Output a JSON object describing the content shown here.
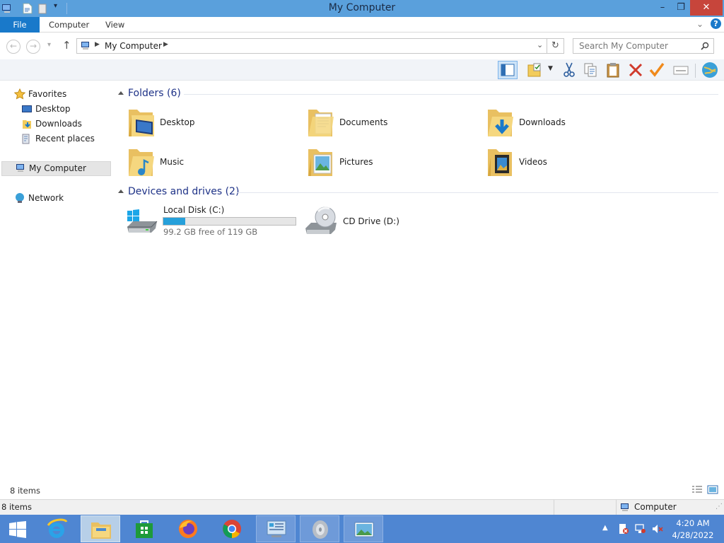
{
  "window": {
    "title": "My Computer",
    "controls": {
      "minimize": "–",
      "restore": "❐",
      "close": "✕"
    }
  },
  "ribbon": {
    "tabs": [
      {
        "label": "File"
      },
      {
        "label": "Computer"
      },
      {
        "label": "View"
      }
    ]
  },
  "address": {
    "path": "My Computer",
    "search_placeholder": "Search My Computer"
  },
  "nav": {
    "favorites": "Favorites",
    "desktop": "Desktop",
    "downloads": "Downloads",
    "recent": "Recent places",
    "computer": "My Computer",
    "network": "Network"
  },
  "content": {
    "folders_header": "Folders (6)",
    "folders": [
      {
        "label": "Desktop",
        "icon": "desktop-folder-icon"
      },
      {
        "label": "Documents",
        "icon": "documents-folder-icon"
      },
      {
        "label": "Downloads",
        "icon": "downloads-folder-icon"
      },
      {
        "label": "Music",
        "icon": "music-folder-icon"
      },
      {
        "label": "Pictures",
        "icon": "pictures-folder-icon"
      },
      {
        "label": "Videos",
        "icon": "videos-folder-icon"
      }
    ],
    "drives_header": "Devices and drives (2)",
    "drives": [
      {
        "label": "Local Disk (C:)",
        "free_text": "99.2 GB free of 119 GB",
        "used_fraction": 0.166
      },
      {
        "label": "CD Drive (D:)"
      }
    ]
  },
  "status": {
    "items": "8 items",
    "bottom_items": "8 items",
    "bottom_location": "Computer"
  },
  "taskbar": {
    "time": "4:20 AM",
    "date": "4/28/2022"
  },
  "colors": {
    "titlebar": "#5aa0dc",
    "taskbar": "#4f86d2",
    "accent": "#1979ca",
    "header_text": "#1e3287",
    "progress": "#26a0da"
  }
}
